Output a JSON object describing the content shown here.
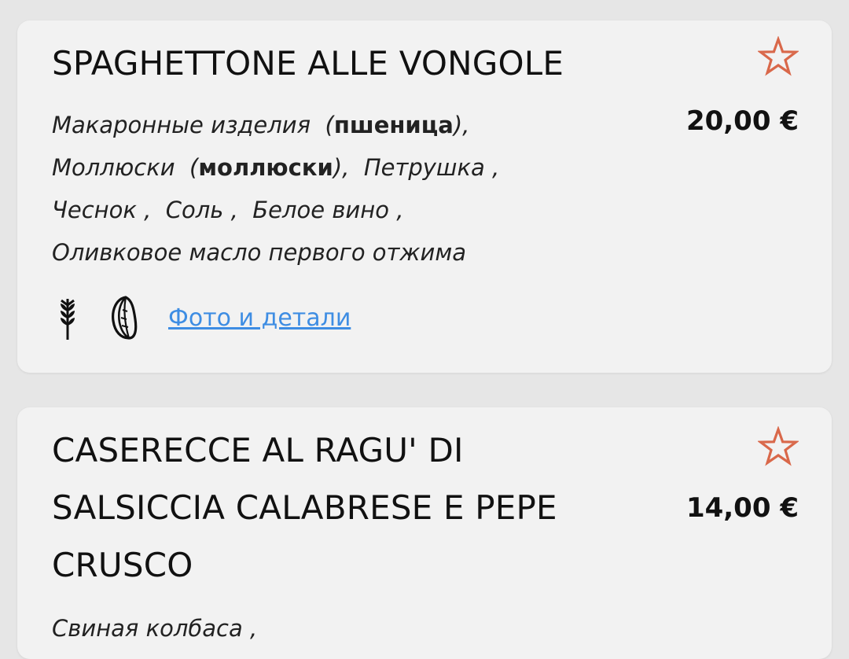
{
  "colors": {
    "page_background": "#e6e6e6",
    "card_background": "#f2f2f2",
    "accent_star": "#d9684a",
    "link": "#3e8de3"
  },
  "menu_items": [
    {
      "title": "SPAGHETTONE ALLE VONGOLE",
      "price": "20,00 €",
      "favorite": false,
      "ingredients": [
        {
          "name": "Макаронные изделия",
          "allergen": "пшеница"
        },
        {
          "name": "Моллюски",
          "allergen": "моллюски"
        },
        {
          "name": "Петрушка"
        },
        {
          "name": "Чеснок"
        },
        {
          "name": "Соль"
        },
        {
          "name": "Белое вино"
        },
        {
          "name": "Оливковое масло первого отжима"
        }
      ],
      "allergen_icons": [
        "wheat-icon",
        "shellfish-icon"
      ],
      "details_link": "Фото и детали"
    },
    {
      "title_lines": [
        "CASERECCE AL RAGU' DI",
        "SALSICCIA CALABRESE E PEPE",
        "CRUSCO"
      ],
      "price": "14,00 €",
      "favorite": false,
      "ingredients": [
        {
          "name": "Свиная колбаса"
        }
      ]
    }
  ]
}
